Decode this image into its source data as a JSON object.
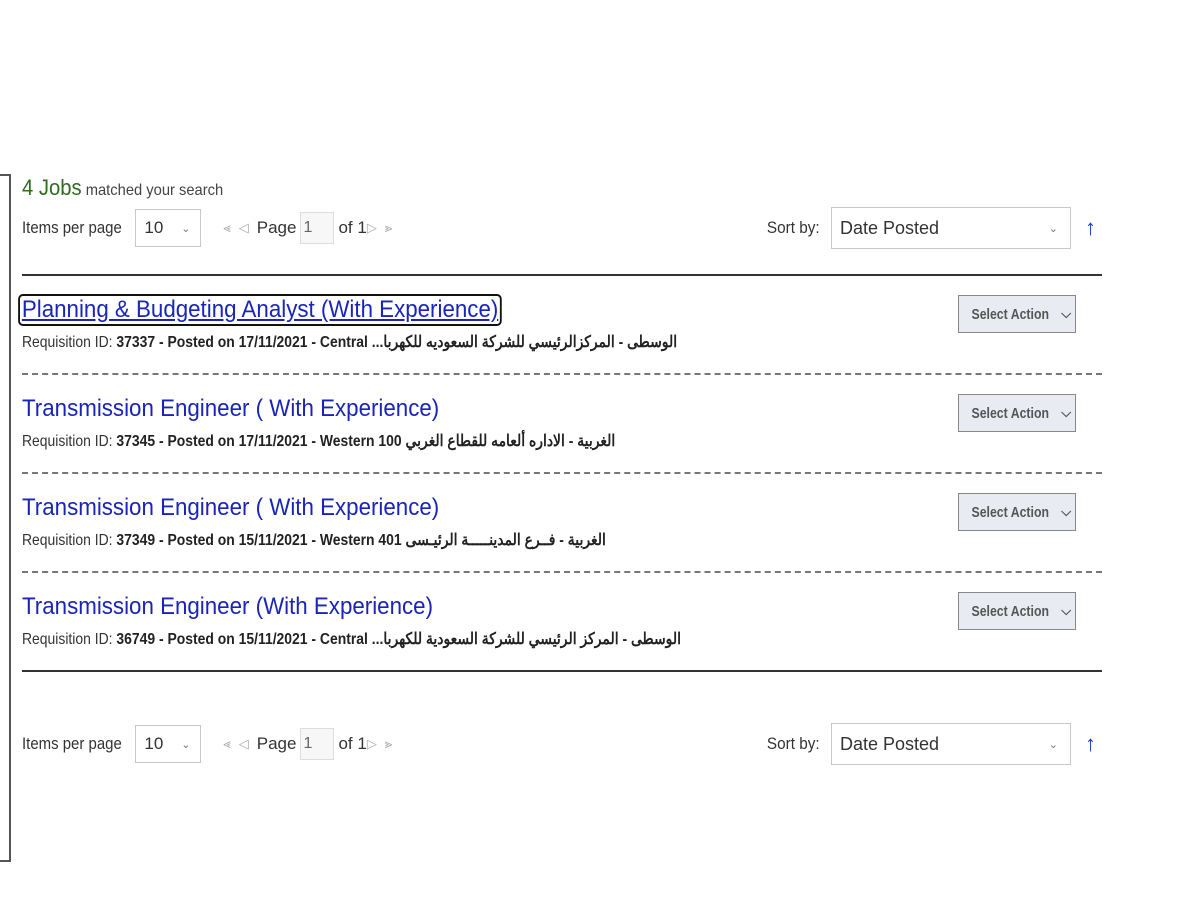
{
  "summary": {
    "count": "4 Jobs",
    "text": "matched your search"
  },
  "pager": {
    "items_per_page_label": "Items per page",
    "items_per_page_value": "10",
    "first_icon": "⪡",
    "prev_icon": "◁",
    "page_label": "Page",
    "page_value": "1",
    "of_label": "of 1",
    "next_icon": "▷",
    "last_icon": "⪢",
    "sort_label": "Sort by:",
    "sort_value": "Date Posted",
    "sort_direction_icon": "↑"
  },
  "jobs": [
    {
      "title": "Planning & Budgeting Analyst (With Experience)",
      "meta_prefix": "Requisition ID: ",
      "meta_bold": "37337 - Posted on 17/11/2021 - Central",
      "meta_arabic": "الوسطى  -  المركزالرئيسي للشركة السعوديه للكهربا...",
      "action": "Select Action"
    },
    {
      "title": "Transmission Engineer ( With Experience)",
      "meta_prefix": "Requisition ID: ",
      "meta_bold": "37345 - Posted on 17/11/2021 - Western 100",
      "meta_arabic": "الغربية  -  الاداره ألعامه للقطاع الغربي",
      "action": "Select Action"
    },
    {
      "title": "Transmission Engineer ( With Experience)",
      "meta_prefix": "Requisition ID: ",
      "meta_bold": "37349 - Posted on 15/11/2021 - Western 401",
      "meta_arabic": "الغربية  -  فــرع المدينـــــة الرئيـسى",
      "action": "Select Action"
    },
    {
      "title": "Transmission Engineer (With Experience)",
      "meta_prefix": "Requisition ID: ",
      "meta_bold": "36749 - Posted on 15/11/2021 - Central",
      "meta_arabic": "الوسطى  -  المركز الرئيسي للشركة السعودية للكهربا...",
      "action": "Select Action"
    }
  ]
}
